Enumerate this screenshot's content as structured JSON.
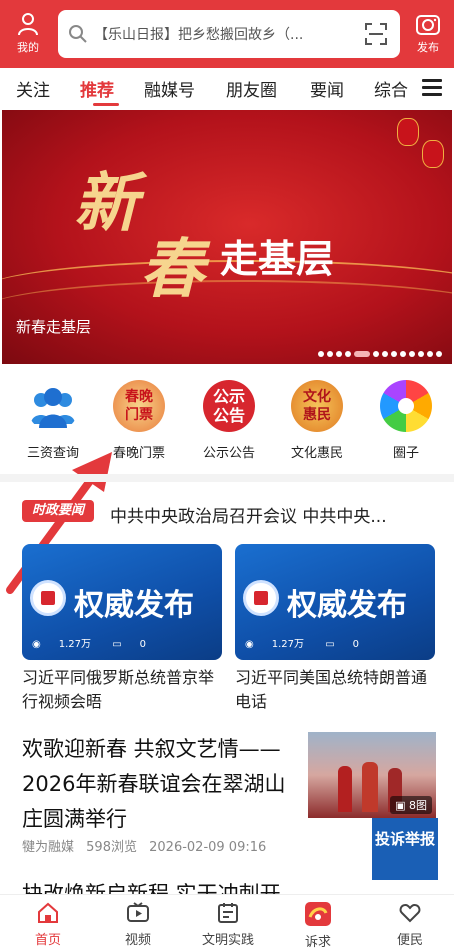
{
  "header": {
    "me_label": "我的",
    "search_text": "【乐山日报】把乡愁搬回故乡（...",
    "publish_label": "发布"
  },
  "tabs": [
    {
      "label": "关注"
    },
    {
      "label": "推荐",
      "active": true
    },
    {
      "label": "融媒号"
    },
    {
      "label": "朋友圈"
    },
    {
      "label": "要闻"
    },
    {
      "label": "综合"
    }
  ],
  "banner": {
    "art_char1": "新",
    "art_char2": "春",
    "art_rest": "走基层",
    "caption": "新春走基层",
    "slide_count": 14,
    "active_slide": 4
  },
  "quick_icons": [
    {
      "label": "三资查询",
      "icon": "people-icon"
    },
    {
      "label": "春晚门票",
      "icon": "ticket-badge-icon",
      "badge_text": "春晚门票"
    },
    {
      "label": "公示公告",
      "icon": "notice-badge-icon",
      "badge_text": "公示公告"
    },
    {
      "label": "文化惠民",
      "icon": "culture-badge-icon",
      "badge_text": "文化惠民"
    },
    {
      "label": "圈子",
      "icon": "pinwheel-icon"
    }
  ],
  "ticker": {
    "tag": "时政要闻",
    "text": "中共中央政治局召开会议 中共中央..."
  },
  "cards": [
    {
      "brand": "权威发布",
      "views": "1.27万",
      "comments": "0",
      "title": "习近平同俄罗斯总统普京举行视频会晤"
    },
    {
      "brand": "权威发布",
      "views": "1.27万",
      "comments": "0",
      "title": "习近平同美国总统特朗普通电话"
    }
  ],
  "feature": {
    "title": "欢歌迎新春 共叙文艺情——2026年新春联谊会在翠湖山庄圆满举行",
    "source": "犍为融媒",
    "views": "598浏览",
    "date": "2026-02-09 09:16",
    "image_count": "8图"
  },
  "report_button": "投诉举报",
  "next_title": "抉改焕新启新程 实干冲刺开",
  "bottom_nav": [
    {
      "label": "首页",
      "active": true,
      "icon": "home-icon"
    },
    {
      "label": "视频",
      "icon": "tv-icon"
    },
    {
      "label": "文明实践",
      "icon": "calendar-icon"
    },
    {
      "label": "诉求",
      "icon": "appeal-logo-icon"
    },
    {
      "label": "便民",
      "icon": "heart-icon"
    }
  ],
  "colors": {
    "brand_red": "#e3393c",
    "card_blue": "#1560c4",
    "report_blue": "#1a5fb5"
  }
}
